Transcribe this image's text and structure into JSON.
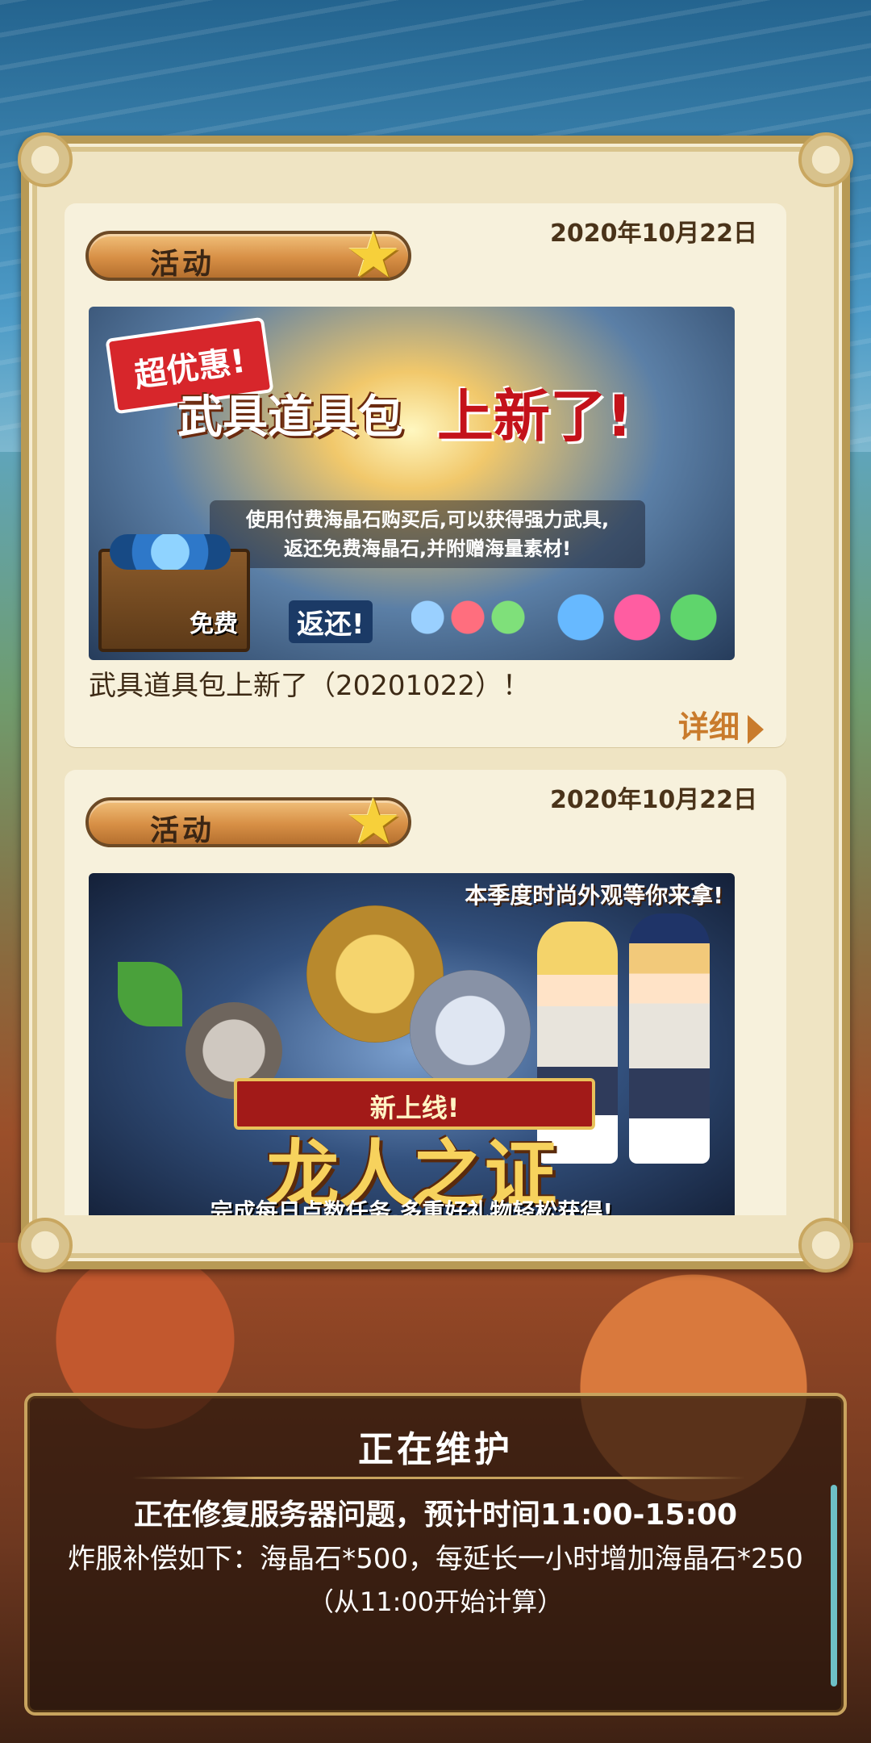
{
  "news": [
    {
      "tag": "活动",
      "date": "2020年10月22日",
      "banner": {
        "burst": "超优惠!",
        "title_part1": "武具道具包",
        "title_part2": "上新了!",
        "desc_line1": "使用付费海晶石购买后,可以获得强力武具,",
        "desc_line2": "返还免费海晶石,并附赠海量素材!",
        "free": "免费",
        "return": "返还!"
      },
      "title": "武具道具包上新了（20201022）！",
      "detail": "详细"
    },
    {
      "tag": "活动",
      "date": "2020年10月22日",
      "banner": {
        "top_text": "本季度时尚外观等你来拿!",
        "ribbon": "新上线!",
        "title": "龙人之证",
        "sub": "完成每日点数任务,多重好礼物轻松获得!"
      }
    }
  ],
  "notice": {
    "title": "正在维护",
    "line1": "正在修复服务器问题，预计时间11:00-15:00",
    "line2": "炸服补偿如下：海晶石*500，每延长一小时增加海晶石*250",
    "line3": "（从11:00开始计算）"
  },
  "icons": {
    "star": "star-icon",
    "arrow": "arrow-right-icon"
  }
}
